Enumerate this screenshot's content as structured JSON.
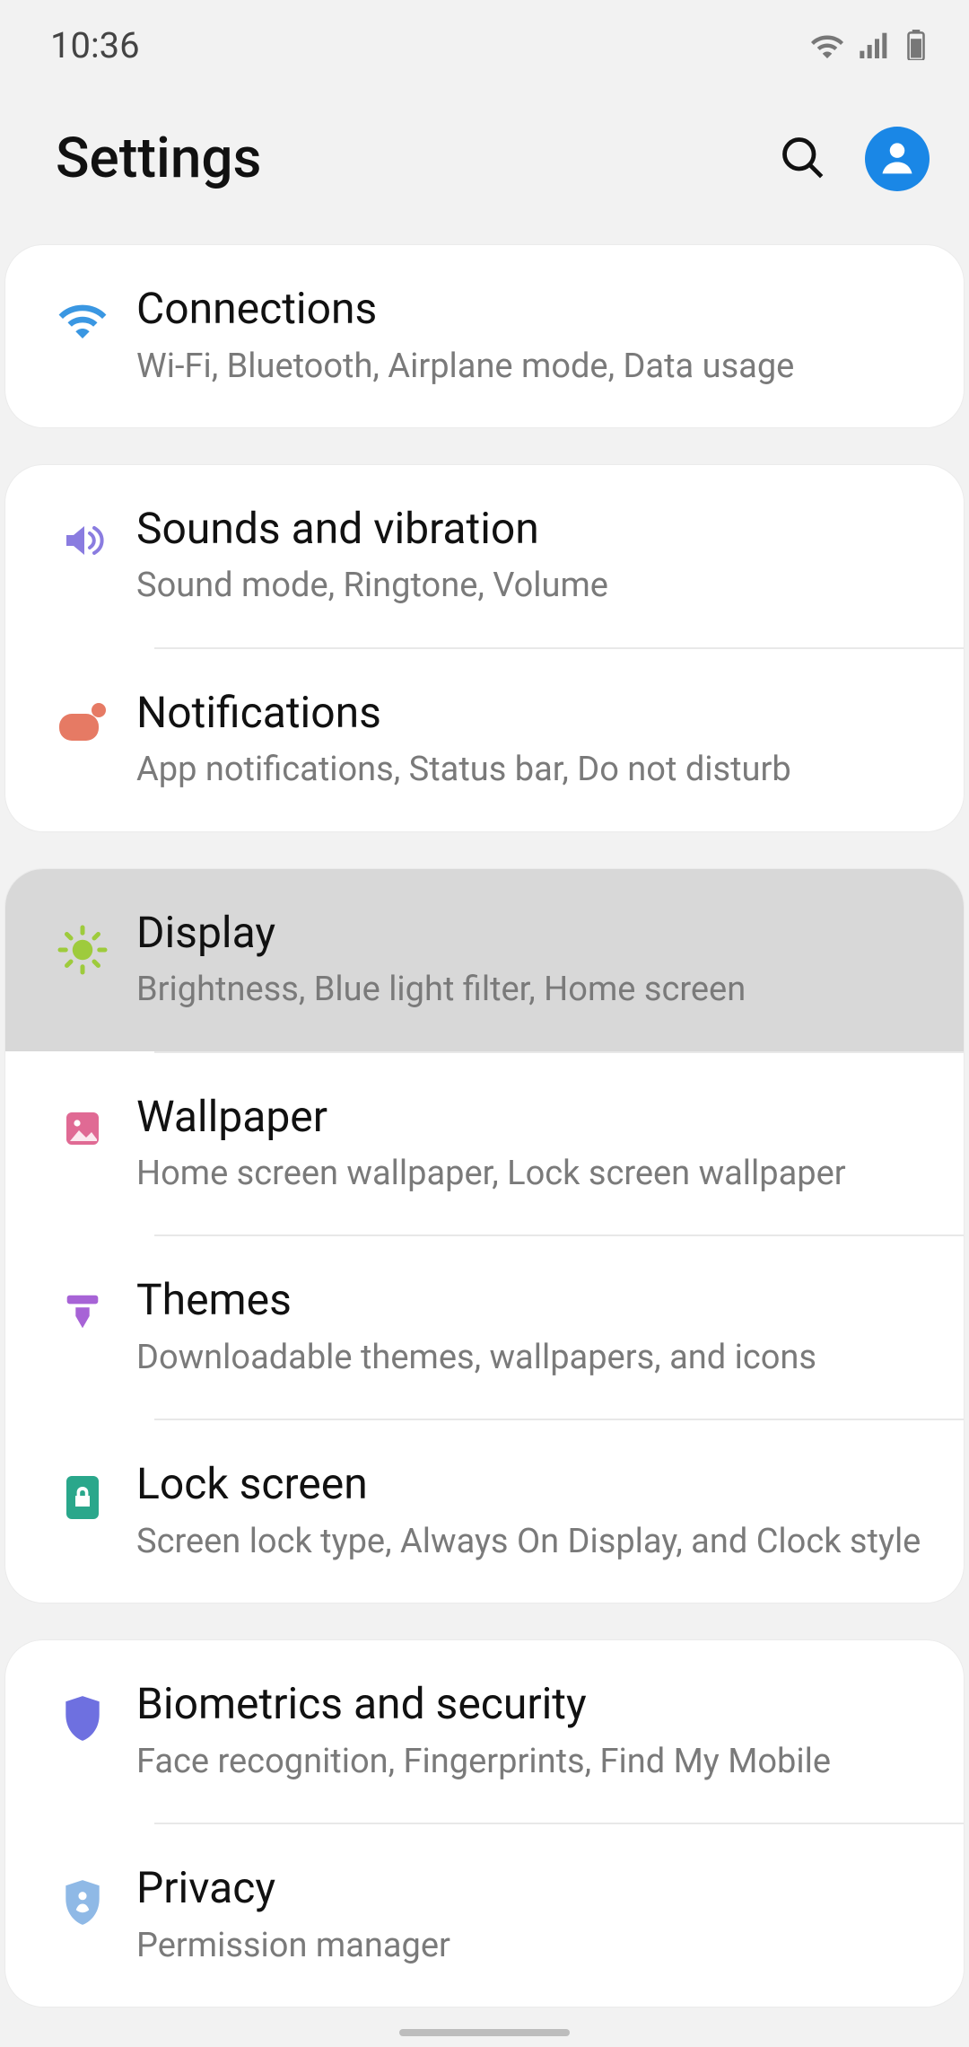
{
  "status": {
    "time": "10:36"
  },
  "header": {
    "title": "Settings"
  },
  "groups": [
    {
      "items": [
        {
          "icon": "wifi",
          "title": "Connections",
          "sub": "Wi-Fi, Bluetooth, Airplane mode, Data usage",
          "name": "connections",
          "pressed": false
        }
      ]
    },
    {
      "items": [
        {
          "icon": "sound",
          "title": "Sounds and vibration",
          "sub": "Sound mode, Ringtone, Volume",
          "name": "sounds-vibration",
          "pressed": false
        },
        {
          "icon": "bell",
          "title": "Notifications",
          "sub": "App notifications, Status bar, Do not disturb",
          "name": "notifications",
          "pressed": false
        }
      ]
    },
    {
      "items": [
        {
          "icon": "brightness",
          "title": "Display",
          "sub": "Brightness, Blue light filter, Home screen",
          "name": "display",
          "pressed": true
        },
        {
          "icon": "wallpaper",
          "title": "Wallpaper",
          "sub": "Home screen wallpaper, Lock screen wallpaper",
          "name": "wallpaper",
          "pressed": false
        },
        {
          "icon": "themes",
          "title": "Themes",
          "sub": "Downloadable themes, wallpapers, and icons",
          "name": "themes",
          "pressed": false
        },
        {
          "icon": "lock",
          "title": "Lock screen",
          "sub": "Screen lock type, Always On Display, and Clock style",
          "name": "lock-screen",
          "pressed": false
        }
      ]
    },
    {
      "items": [
        {
          "icon": "shield",
          "title": "Biometrics and security",
          "sub": "Face recognition, Fingerprints, Find My Mobile",
          "name": "biometrics-security",
          "pressed": false
        },
        {
          "icon": "privacy",
          "title": "Privacy",
          "sub": "Permission manager",
          "name": "privacy",
          "pressed": false
        }
      ]
    }
  ],
  "iconColors": {
    "wifi": "#3a97e2",
    "sound": "#8a7ce0",
    "bell": "#e67a64",
    "brightness": "#9ecb3c",
    "wallpaper": "#e06a94",
    "themes": "#a763d6",
    "lock": "#2aa78b",
    "shield": "#6e70e0",
    "privacy": "#8fb9e6"
  }
}
